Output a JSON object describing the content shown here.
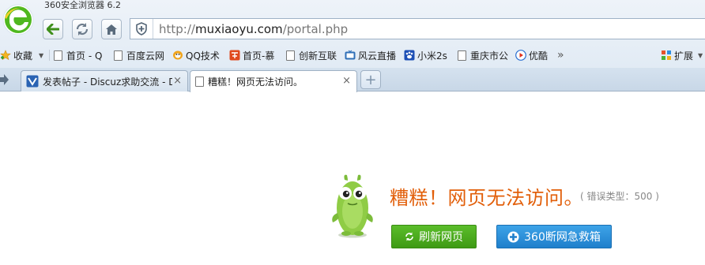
{
  "app": {
    "title": "360安全浏览器 6.2"
  },
  "address_bar": {
    "url_prefix": "http://",
    "url_domain": "muxiaoyu.com",
    "url_path": "/portal.php"
  },
  "bookmarks": {
    "favorites_label": "收藏",
    "items": [
      {
        "label": "首页 - Q",
        "icon": "page-icon"
      },
      {
        "label": "百度云网",
        "icon": "page-icon"
      },
      {
        "label": "QQ技术",
        "icon": "qq-penguin-icon"
      },
      {
        "label": "首页-慕",
        "icon": "red-site-icon"
      },
      {
        "label": "创新互联",
        "icon": "page-icon"
      },
      {
        "label": "风云直播",
        "icon": "tv-icon"
      },
      {
        "label": "小米2s",
        "icon": "paw-icon"
      },
      {
        "label": "重庆市公",
        "icon": "page-icon"
      },
      {
        "label": "优酷",
        "icon": "youku-play-icon"
      }
    ],
    "more_label": "»",
    "extensions_label": "扩展"
  },
  "tabs": [
    {
      "label": "发表帖子 - Discuz求助交流 - D",
      "active": false
    },
    {
      "label": "糟糕！网页无法访问。",
      "active": true
    }
  ],
  "tab_close_glyph": "×",
  "new_tab_glyph": "+",
  "error_page": {
    "title": "糟糕！网页无法访问。",
    "error_type": "( 错误类型：500 )",
    "refresh_button": "刷新网页",
    "rescue_button": "360断网急救箱"
  },
  "colors": {
    "error_title": "#e25f0a",
    "refresh_button": "#4caf1e",
    "rescue_button": "#2a8fdc"
  }
}
